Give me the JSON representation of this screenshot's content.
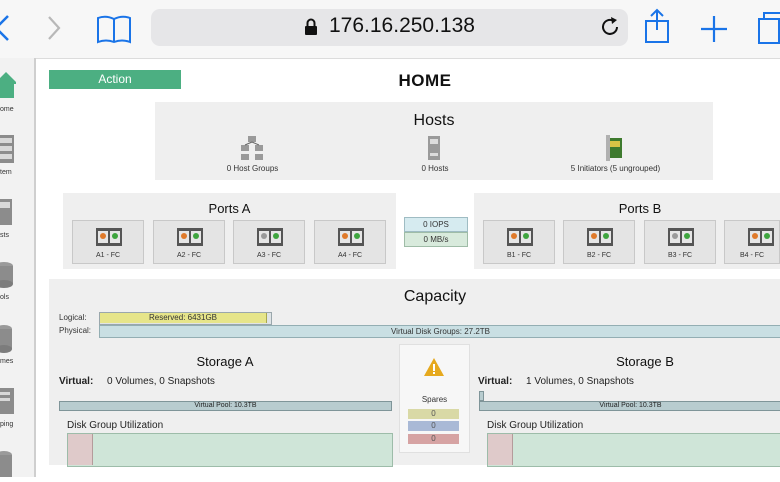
{
  "browser": {
    "url": "176.16.250.138"
  },
  "action_button": "Action",
  "page_title": "HOME",
  "rail": {
    "items": [
      "ome",
      "tem",
      "sts",
      "ols",
      "mes",
      "ping"
    ]
  },
  "hosts": {
    "title": "Hosts",
    "host_groups": "0 Host Groups",
    "hosts": "0 Hosts",
    "initiators": "5 Initiators (5 ungrouped)"
  },
  "ports_a": {
    "title": "Ports A",
    "ports": [
      "A1 - FC",
      "A2 - FC",
      "A3 - FC",
      "A4 - FC"
    ]
  },
  "ports_b": {
    "title": "Ports B",
    "ports": [
      "B1 - FC",
      "B2 - FC",
      "B3 - FC",
      "B4 - FC"
    ]
  },
  "throughput": {
    "iops": "0 IOPS",
    "mbs": "0 MB/s"
  },
  "capacity": {
    "title": "Capacity",
    "logical_label": "Logical:",
    "physical_label": "Physical:",
    "reserved": "Reserved: 6431GB",
    "virtual_disk_groups": "Virtual Disk Groups: 27.2TB"
  },
  "storage_a": {
    "title": "Storage A",
    "virtual_label": "Virtual:",
    "virtual_value": "0 Volumes, 0 Snapshots",
    "pool": "Virtual Pool: 10.3TB",
    "dgu": "Disk Group Utilization"
  },
  "storage_b": {
    "title": "Storage B",
    "virtual_label": "Virtual:",
    "virtual_value": "1 Volumes, 0 Snapshots",
    "pool": "Virtual Pool: 10.3TB",
    "dgu": "Disk Group Utilization"
  },
  "spares": {
    "title": "Spares",
    "values": [
      "0",
      "0",
      "0"
    ],
    "colors": [
      "#d9d9a6",
      "#a9b9d6",
      "#d6a3a3"
    ]
  },
  "colors": {
    "action": "#4caf82",
    "accent_blue": "#1a74e8"
  }
}
